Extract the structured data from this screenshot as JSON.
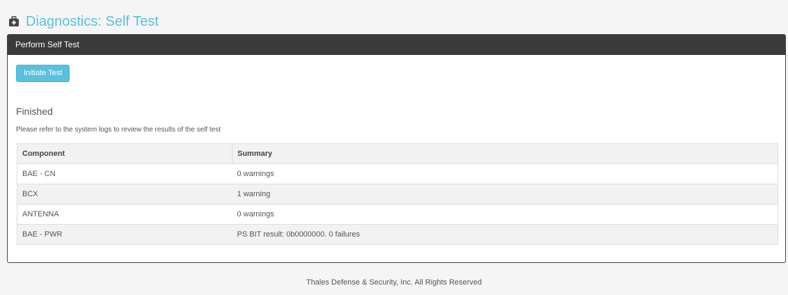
{
  "page": {
    "title": "Diagnostics: Self Test",
    "title_icon": "briefcase-medical-icon"
  },
  "panel": {
    "heading": "Perform Self Test",
    "initiate_button_label": "Initiate Test",
    "status_heading": "Finished",
    "status_description": "Please refer to the system logs to review the results of the self test"
  },
  "results": {
    "columns": [
      "Component",
      "Summary"
    ],
    "rows": [
      {
        "component": "BAE - CN",
        "summary": "0 warnings"
      },
      {
        "component": "BCX",
        "summary": "1 warning"
      },
      {
        "component": "ANTENNA",
        "summary": "0 warnings"
      },
      {
        "component": "BAE - PWR",
        "summary": "PS BIT result: 0b0000000. 0 failures"
      }
    ]
  },
  "footer": {
    "text": "Thales Defense & Security, Inc. All Rights Reserved"
  },
  "colors": {
    "accent": "#5bc0de",
    "panel_header": "#3a3a3a"
  }
}
